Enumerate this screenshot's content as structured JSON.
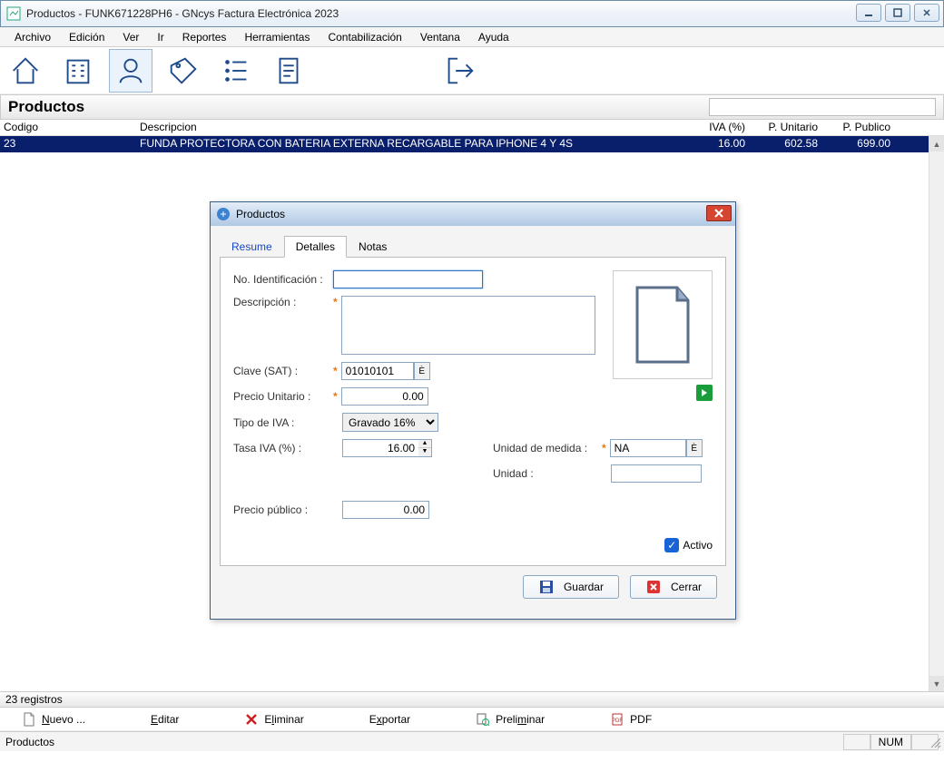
{
  "window": {
    "title": "Productos - FUNK671228PH6 - GNcys Factura Electrónica 2023"
  },
  "menu": [
    "Archivo",
    "Edición",
    "Ver",
    "Ir",
    "Reportes",
    "Herramientas",
    "Contabilización",
    "Ventana",
    "Ayuda"
  ],
  "section_title": "Productos",
  "columns": {
    "codigo": "Codigo",
    "descripcion": "Descripcion",
    "iva": "IVA (%)",
    "punitario": "P. Unitario",
    "ppublico": "P. Publico"
  },
  "row": {
    "codigo": "23",
    "descripcion": "FUNDA PROTECTORA CON BATERIA EXTERNA RECARGABLE PARA IPHONE 4 Y 4S",
    "iva": "16.00",
    "punitario": "602.58",
    "ppublico": "699.00"
  },
  "dialog": {
    "title": "Productos",
    "tabs": {
      "resume": "Resume",
      "detalles": "Detalles",
      "notas": "Notas"
    },
    "labels": {
      "no_identificacion": "No. Identificación :",
      "descripcion": "Descripción :",
      "clave_sat": "Clave (SAT) :",
      "precio_unitario": "Precio Unitario :",
      "tipo_iva": "Tipo de IVA :",
      "tasa_iva": "Tasa IVA (%) :",
      "precio_publico": "Precio público :",
      "unidad_medida": "Unidad de medida :",
      "unidad": "Unidad :",
      "activo": "Activo"
    },
    "values": {
      "no_identificacion": "",
      "descripcion": "",
      "clave_sat": "01010101",
      "precio_unitario": "0.00",
      "tipo_iva": "Gravado 16%",
      "tasa_iva": "16.00",
      "precio_publico": "0.00",
      "unidad_medida": "NA",
      "unidad": "",
      "activo": true
    },
    "buttons": {
      "guardar": "Guardar",
      "cerrar": "Cerrar"
    }
  },
  "row_count": "23 registros",
  "actions": {
    "nuevo": "Nuevo ...",
    "editar": "Editar",
    "eliminar": "Eliminar",
    "exportar": "Exportar",
    "preliminar": "Preliminar",
    "pdf": "PDF"
  },
  "status": {
    "left": "Productos",
    "num": "NUM"
  }
}
